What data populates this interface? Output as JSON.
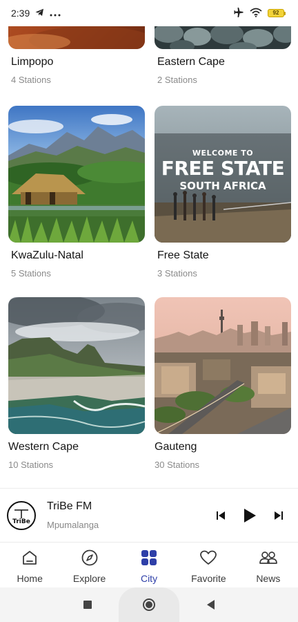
{
  "status": {
    "time": "2:39",
    "battery": "92",
    "icons": [
      "telegram-icon",
      "more-icon",
      "airplane-icon",
      "wifi-icon",
      "battery-icon"
    ]
  },
  "cards": [
    {
      "name": "Limpopo",
      "stations": "4 Stations"
    },
    {
      "name": "Eastern Cape",
      "stations": "2 Stations"
    },
    {
      "name": "KwaZulu-Natal",
      "stations": "5 Stations"
    },
    {
      "name": "Free State",
      "stations": "3 Stations"
    },
    {
      "name": "Western Cape",
      "stations": "10 Stations"
    },
    {
      "name": "Gauteng",
      "stations": "30 Stations"
    }
  ],
  "free_state_banner": {
    "line1": "WELCOME TO",
    "line2": "FREE STATE",
    "line3": "SOUTH AFRICA"
  },
  "now_playing": {
    "station": "TriBe FM",
    "city": "Mpumalanga",
    "logo_text": "TriBe"
  },
  "nav": {
    "items": [
      {
        "label": "Home",
        "icon": "home-icon"
      },
      {
        "label": "Explore",
        "icon": "compass-icon"
      },
      {
        "label": "City",
        "icon": "grid-icon",
        "active": true
      },
      {
        "label": "Favorite",
        "icon": "heart-icon"
      },
      {
        "label": "News",
        "icon": "people-icon"
      }
    ]
  },
  "colors": {
    "active": "#2e3fa8",
    "inactive": "#3a3a3a",
    "subtitle": "#8a8a8a"
  }
}
